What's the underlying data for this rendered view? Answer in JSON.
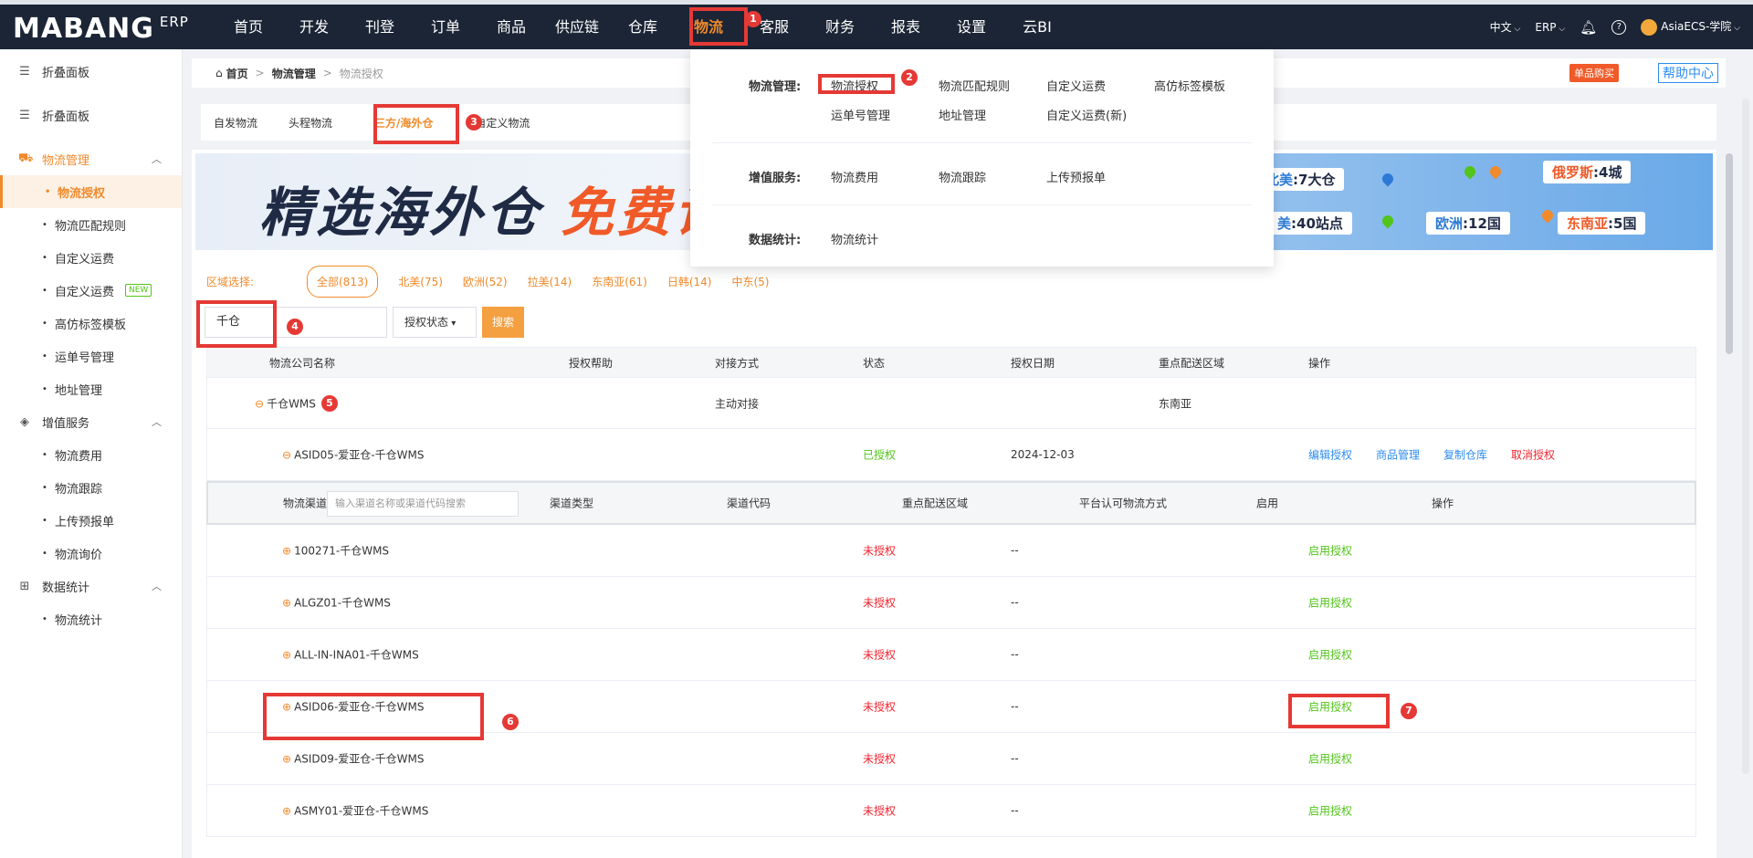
{
  "topbar": {
    "logo": "MABANG",
    "logo_sub": "ERP",
    "nav": [
      "首页",
      "开发",
      "刊登",
      "订单",
      "商品",
      "供应链",
      "仓库",
      "物流",
      "客服",
      "财务",
      "报表",
      "设置",
      "云BI"
    ],
    "active_nav": "物流",
    "lang": "中文",
    "erp": "ERP",
    "user": "AsiaECS-学院"
  },
  "sidebar": {
    "collapse1": "折叠面板",
    "collapse2": "折叠面板",
    "group1": "物流管理",
    "group1_items": [
      "物流授权",
      "物流匹配规则",
      "自定义运费",
      "自定义运费",
      "高仿标签模板",
      "运单号管理",
      "地址管理"
    ],
    "new_tag": "NEW",
    "group2": "增值服务",
    "group2_items": [
      "物流费用",
      "物流跟踪",
      "上传预报单",
      "物流询价"
    ],
    "group3": "数据统计",
    "group3_items": [
      "物流统计"
    ]
  },
  "breadcrumb": {
    "home": "首页",
    "level1": "物流管理",
    "level2": "物流授权"
  },
  "header_buttons": {
    "single_buy": "单品购买",
    "help": "帮助中心"
  },
  "tabs": [
    "自发物流",
    "头程物流",
    "三方/海外仓",
    "自定义物流"
  ],
  "active_tab": "三方/海外仓",
  "banner": {
    "title_part1": "精选海外仓",
    "title_part2": "免费试",
    "tags": [
      {
        "region": "北美",
        "value": ":7大仓"
      },
      {
        "region": "俄罗斯",
        "value": ":4城"
      },
      {
        "region": "美",
        "value": ":40站点"
      },
      {
        "region": "欧洲",
        "value": ":12国"
      },
      {
        "region": "东南亚",
        "value": ":5国"
      }
    ]
  },
  "region_filter": {
    "label": "区域选择:",
    "items": [
      "全部(813)",
      "北美(75)",
      "欧洲(52)",
      "拉美(14)",
      "东南亚(61)",
      "日韩(14)",
      "中东(5)"
    ]
  },
  "search": {
    "value": "千仓",
    "status_select": "授权状态",
    "button": "搜索"
  },
  "table": {
    "headers": [
      "物流公司名称",
      "授权帮助",
      "对接方式",
      "状态",
      "授权日期",
      "重点配送区域",
      "操作"
    ],
    "company": {
      "name": "千仓WMS",
      "method": "主动对接",
      "region": "东南亚"
    },
    "authorized": {
      "name": "ASID05-爱亚仓-千仓WMS",
      "status": "已授权",
      "date": "2024-12-03",
      "actions": [
        "编辑授权",
        "商品管理",
        "复制仓库",
        "取消授权"
      ]
    },
    "channel_headers": [
      "物流渠道",
      "渠道类型",
      "渠道代码",
      "重点配送区域",
      "平台认可物流方式",
      "启用",
      "操作"
    ],
    "channel_placeholder": "输入渠道名称或渠道代码搜索",
    "rows": [
      {
        "name": "100271-千仓WMS",
        "status": "未授权",
        "date": "--",
        "action": "启用授权"
      },
      {
        "name": "ALGZ01-千仓WMS",
        "status": "未授权",
        "date": "--",
        "action": "启用授权"
      },
      {
        "name": "ALL-IN-INA01-千仓WMS",
        "status": "未授权",
        "date": "--",
        "action": "启用授权"
      },
      {
        "name": "ASID06-爱亚仓-千仓WMS",
        "status": "未授权",
        "date": "--",
        "action": "启用授权"
      },
      {
        "name": "ASID09-爱亚仓-千仓WMS",
        "status": "未授权",
        "date": "--",
        "action": "启用授权"
      },
      {
        "name": "ASMY01-爱亚仓-千仓WMS",
        "status": "未授权",
        "date": "--",
        "action": "启用授权"
      }
    ]
  },
  "dropdown": {
    "section1_label": "物流管理:",
    "section1_items": [
      "物流授权",
      "物流匹配规则",
      "自定义运费",
      "高仿标签模板",
      "运单号管理",
      "地址管理",
      "自定义运费(新)"
    ],
    "section2_label": "增值服务:",
    "section2_items": [
      "物流费用",
      "物流跟踪",
      "上传预报单"
    ],
    "section3_label": "数据统计:",
    "section3_items": [
      "物流统计"
    ]
  },
  "annotations": [
    "1",
    "2",
    "3",
    "4",
    "5",
    "6",
    "7"
  ],
  "colors": {
    "accent": "#f08a2a",
    "topbar": "#1b2535",
    "annotation": "#e53935"
  }
}
